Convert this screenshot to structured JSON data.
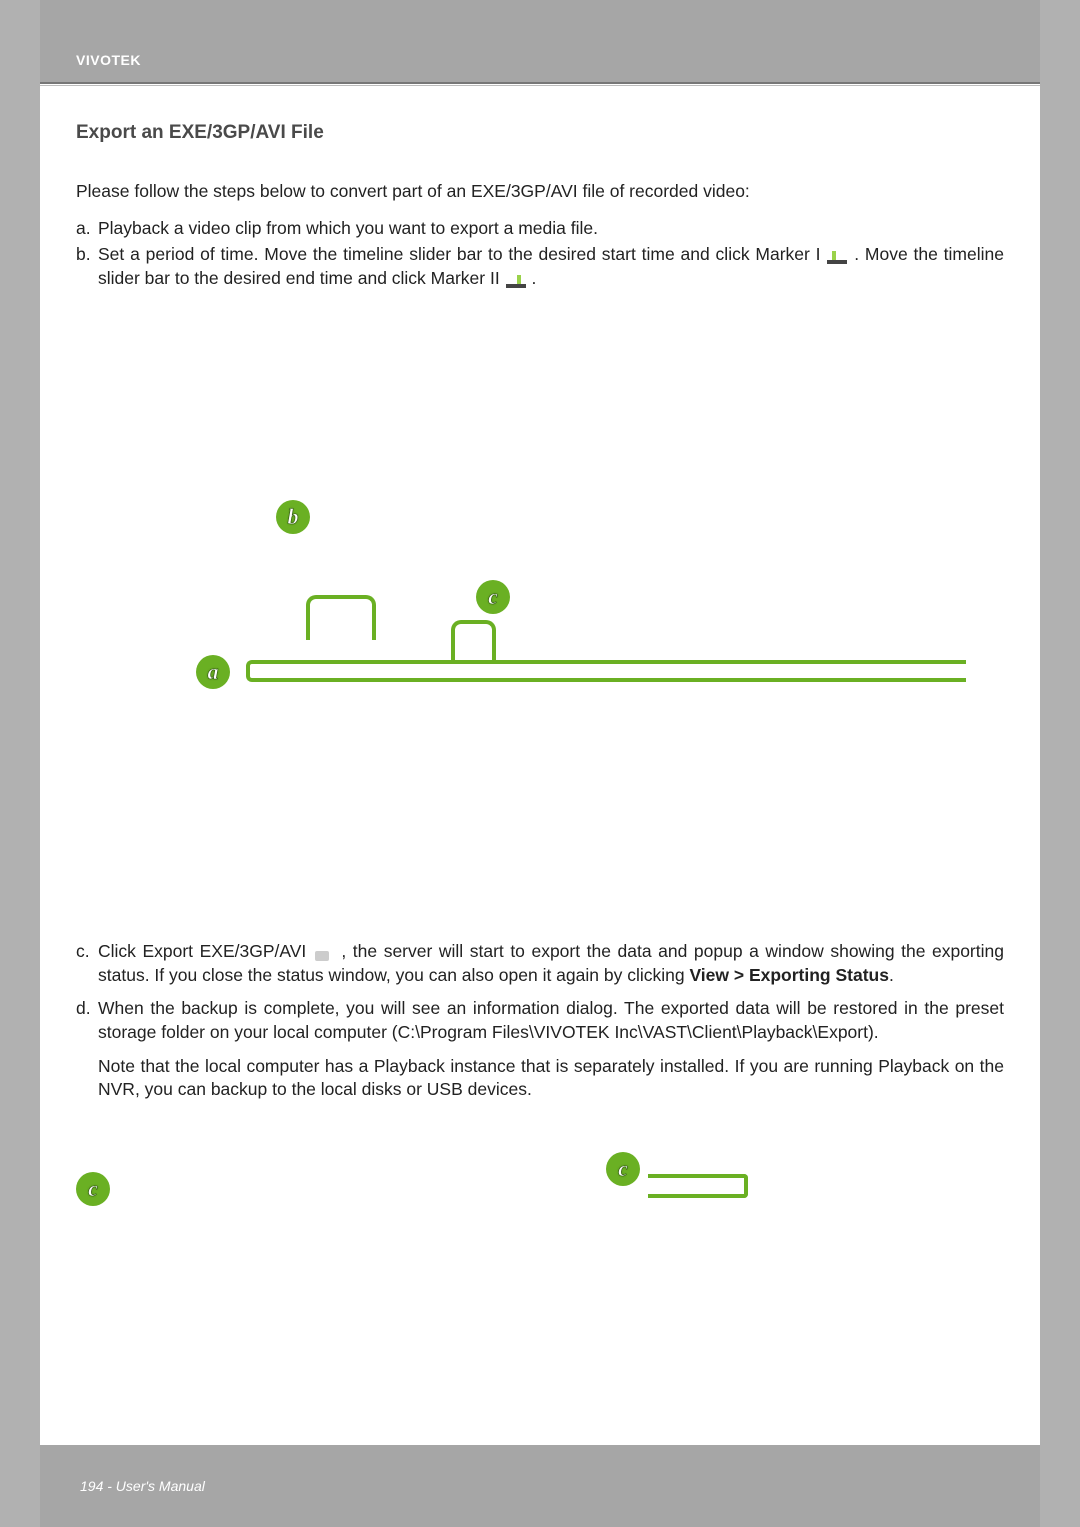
{
  "header": {
    "brand": "VIVOTEK"
  },
  "title": "Export an EXE/3GP/AVI File",
  "intro": "Please follow the steps below to convert part of an EXE/3GP/AVI file of recorded video:",
  "steps": {
    "a": {
      "label": "a.",
      "text": "Playback a video clip from which you want to export a media file."
    },
    "b": {
      "label": "b.",
      "text_pre": "Set a period of time. Move the timeline slider bar to the desired start time and click Marker I ",
      "text_mid": ". Move the timeline slider bar to the desired end time and click Marker II ",
      "text_post": "."
    },
    "c": {
      "label": "c.",
      "text_pre": "Click Export EXE/3GP/AVI ",
      "text_post": ", the server will start to export the data and popup a window showing the exporting status. If you close the status window, you can also open it again by clicking ",
      "bold": "View > Exporting Status",
      "tail": "."
    },
    "d": {
      "label": "d.",
      "text": "When the backup is complete, you will see an information dialog. The exported data will be restored in the preset storage folder on your local computer (C:\\Program Files\\VIVOTEK Inc\\VAST\\Client\\Playback\\Export)."
    },
    "note": "Note that the local computer has a Playback instance that is separately installed. If you are running Playback on the NVR, you can backup to the local disks or USB devices."
  },
  "badges": {
    "a": "a",
    "b": "b",
    "c": "c"
  },
  "footer": {
    "text": "194 - User's Manual"
  }
}
